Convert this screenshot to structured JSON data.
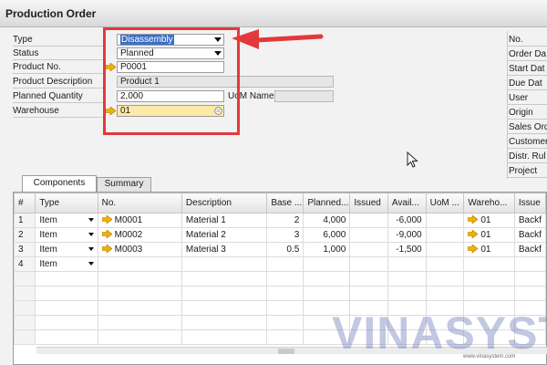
{
  "window": {
    "title": "Production Order"
  },
  "header": {
    "type": {
      "label": "Type",
      "value": "Disassembly"
    },
    "status": {
      "label": "Status",
      "value": "Planned"
    },
    "product_no": {
      "label": "Product No.",
      "value": "P0001"
    },
    "product_description": {
      "label": "Product Description",
      "value": "Product 1"
    },
    "planned_quantity": {
      "label": "Planned Quantity",
      "value": "2,000"
    },
    "uom_name": {
      "label": "UoM Name",
      "value": ""
    },
    "warehouse": {
      "label": "Warehouse",
      "value": "01"
    }
  },
  "right_panel": {
    "labels": [
      "No.",
      "Order Da",
      "Start Dat",
      "Due Dat",
      "User",
      "Origin",
      "Sales Ord",
      "Customer",
      "Distr. Rul",
      "Project"
    ]
  },
  "tabs": [
    {
      "label": "Components",
      "active": true
    },
    {
      "label": "Summary",
      "active": false
    }
  ],
  "grid": {
    "columns": [
      "#",
      "Type",
      "No.",
      "Description",
      "Base ...",
      "Planned...",
      "Issued",
      "Avail...",
      "UoM ...",
      "Wareho...",
      "Issue"
    ],
    "rows": [
      {
        "n": "1",
        "type": "Item",
        "no": "M0001",
        "desc": "Material 1",
        "base": "2",
        "planned": "4,000",
        "issued": "",
        "avail": "-6,000",
        "uom": "",
        "wh": "01",
        "issue": "Backf"
      },
      {
        "n": "2",
        "type": "Item",
        "no": "M0002",
        "desc": "Material 2",
        "base": "3",
        "planned": "6,000",
        "issued": "",
        "avail": "-9,000",
        "uom": "",
        "wh": "01",
        "issue": "Backf"
      },
      {
        "n": "3",
        "type": "Item",
        "no": "M0003",
        "desc": "Material 3",
        "base": "0.5",
        "planned": "1,000",
        "issued": "",
        "avail": "-1,500",
        "uom": "",
        "wh": "01",
        "issue": "Backf"
      },
      {
        "n": "4",
        "type": "Item",
        "no": "",
        "desc": "",
        "base": "",
        "planned": "",
        "issued": "",
        "avail": "",
        "uom": "",
        "wh": "",
        "issue": ""
      }
    ]
  },
  "watermark": {
    "brand": "VINASYSTEM",
    "url": "www.vinasystem.com"
  },
  "colors": {
    "highlight": "#e3393b",
    "link_arrow": "#f2b100",
    "selection": "#3a6fc6",
    "warehouse_field": "#fde9a8"
  }
}
